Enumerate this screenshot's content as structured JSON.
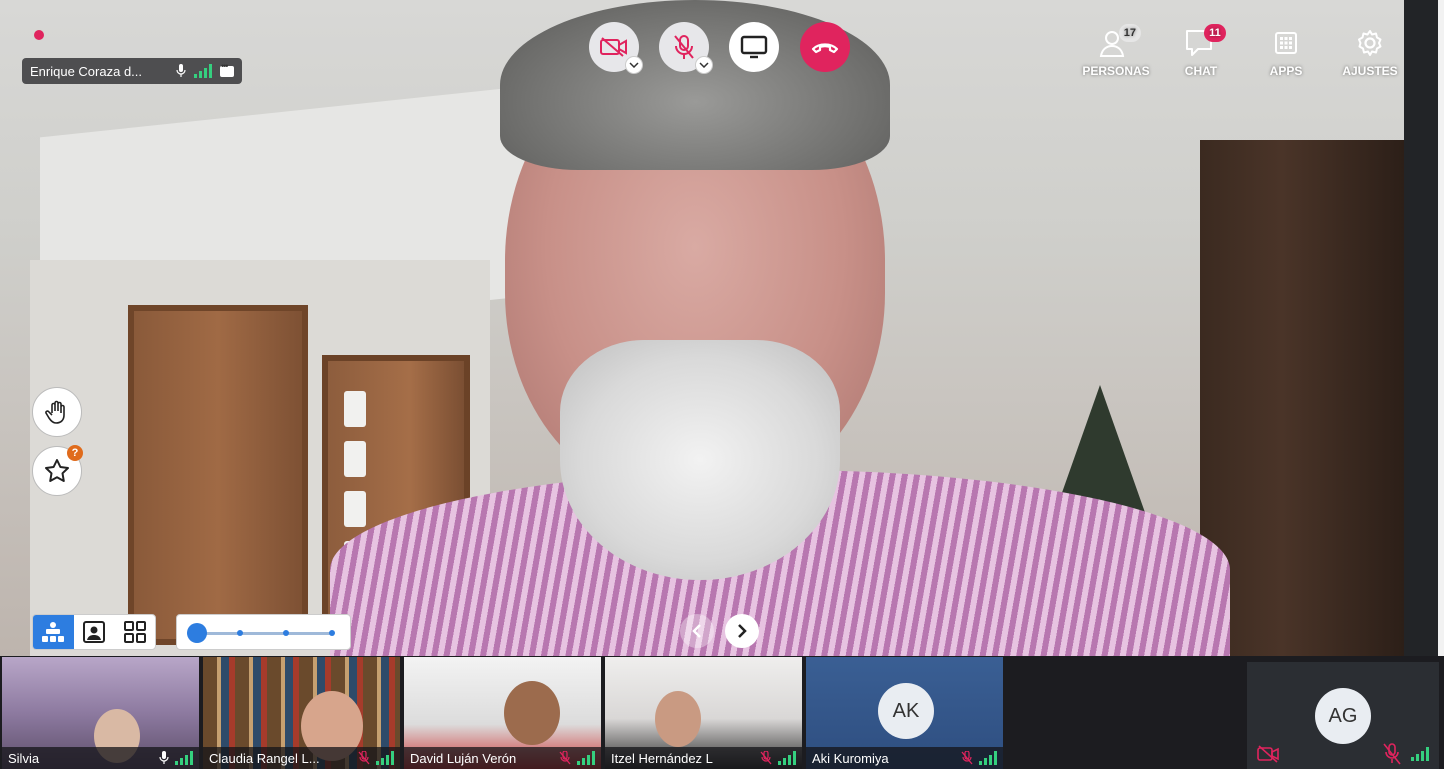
{
  "main_speaker": {
    "name": "Enrique Coraza d..."
  },
  "controls": {
    "camera": "video-off",
    "microphone": "muted",
    "share": "screen-share",
    "hangup": "end-call"
  },
  "top_nav": [
    {
      "label": "PERSONAS",
      "icon": "people-icon",
      "badge": "17"
    },
    {
      "label": "CHAT",
      "icon": "chat-icon",
      "badge": "11"
    },
    {
      "label": "APPS",
      "icon": "apps-grid-icon",
      "badge": ""
    },
    {
      "label": "AJUSTES",
      "icon": "gear-icon",
      "badge": ""
    }
  ],
  "side_buttons": {
    "raise_hand": "hand-icon",
    "star": "star-icon",
    "star_badge": "?"
  },
  "participants": [
    {
      "name": "Silvia",
      "mic": "on"
    },
    {
      "name": "Claudia Rangel L...",
      "mic": "muted"
    },
    {
      "name": "David Luján Verón",
      "mic": "muted"
    },
    {
      "name": "Itzel Hernández L",
      "mic": "muted"
    },
    {
      "name": "Aki Kuromiya",
      "mic": "muted",
      "initials": "AK"
    }
  ],
  "self_view": {
    "initials": "AG",
    "camera": "off",
    "mic": "muted"
  },
  "colors": {
    "accent_pink": "#e0245e",
    "accent_blue": "#2d7de0",
    "signal_green": "#35d07f"
  }
}
